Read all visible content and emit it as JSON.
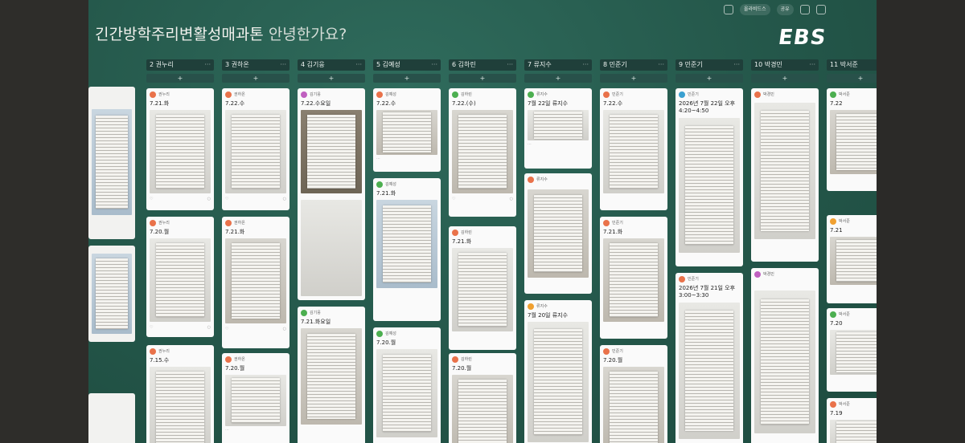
{
  "board": {
    "title_main": "긴간방학주리변활성매과톤",
    "title_greeting": "안녕한가요?",
    "logo": "EBS",
    "topbar": {
      "pill_label": "올라비드스",
      "share_label": "공유"
    }
  },
  "columns": [
    {
      "label": "2 권누리"
    },
    {
      "label": "3 권하온"
    },
    {
      "label": "4 김기웅"
    },
    {
      "label": "5 김예성"
    },
    {
      "label": "6 김하린"
    },
    {
      "label": "7 류지수"
    },
    {
      "label": "8 민준기"
    },
    {
      "label": "9 민준기"
    },
    {
      "label": "10 박경민"
    },
    {
      "label": "11 박서준"
    }
  ],
  "add_label": "+",
  "cards": {
    "c2a": "7.21.화",
    "c2b": "7.20.월",
    "c2c": "7.15.수",
    "c3a": "7.22.수",
    "c3b": "7.21.화",
    "c3c": "7.20.월",
    "c4a": "7.22.수요일",
    "c4b": "7.21.화요일",
    "c5a": "7.22.수",
    "c5b": "7.21.화",
    "c5c": "7.20.월",
    "c6a": "7.22.(수)",
    "c6b": "7.21.화",
    "c6c": "7.20.월",
    "c7a": "7월 22일 류지수",
    "c7b": "7월 20일 류지수",
    "c8a": "7.22.수",
    "c8b": "7.21.화",
    "c8c": "7.20.월",
    "c9a": "2026년 7월 22일 오후 4:20~4:50",
    "c9b": "2026년 7월 21일 오후 3:00~3:30",
    "c11a": "7.22",
    "c11b": "7.21",
    "c11c": "7.20",
    "c11d": "7.19"
  }
}
